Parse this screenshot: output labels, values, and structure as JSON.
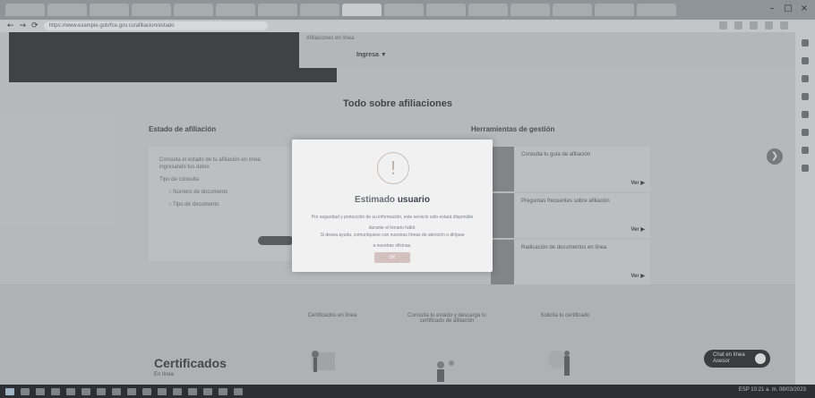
{
  "browser": {
    "url": "https://www.example.gob/fce.gov.co/afiliacion/estado",
    "nav_back": "←",
    "nav_forward": "→",
    "nav_reload": "⟳",
    "win_min": "–",
    "win_max": "□",
    "win_close": "×"
  },
  "hero": {
    "small_text": "Afiliaciones en línea",
    "link": "Ingresa ▼"
  },
  "section_title": "Todo sobre afiliaciones",
  "left": {
    "title": "Estado de afiliación",
    "lines": [
      "Consulta el estado de tu afiliación en línea",
      "ingresando tus datos",
      "Tipo de consulta",
      "○ Número de documento",
      "○ Tipo de documento"
    ]
  },
  "right": {
    "title": "Herramientas de gestión",
    "news": [
      {
        "text": "Consulta tu guía de afiliación",
        "more": "Ver ▶"
      },
      {
        "text": "Preguntas frecuentes sobre afiliación",
        "more": "Ver ▶"
      },
      {
        "text": "Radicación de documentos en línea",
        "more": "Ver ▶"
      }
    ],
    "carousel_arrow": "❯"
  },
  "lower": {
    "captions": [
      "Certificados en línea",
      "Consulta tu estado y descarga tu certificado de afiliación",
      "Solicita tu certificado"
    ],
    "cert_title": "Certificados",
    "cert_small": "En línea",
    "chat_label": "Chat en línea",
    "chat_sub": "Asesor"
  },
  "modal": {
    "warn_icon": "!",
    "title_plain": "Estimado ",
    "title_accent": "usuario",
    "text1": "Por seguridad y protección de su información, este servicio solo estará disponible",
    "text2": "durante el horario hábil.",
    "text3": "Si desea ayuda, comuníquese con nuestras líneas de atención o diríjase",
    "text4": "a nuestras oficinas.",
    "ok_label": "OK"
  },
  "taskbar": {
    "tray_text": "ESP  10:21 a. m.  08/03/2023"
  }
}
